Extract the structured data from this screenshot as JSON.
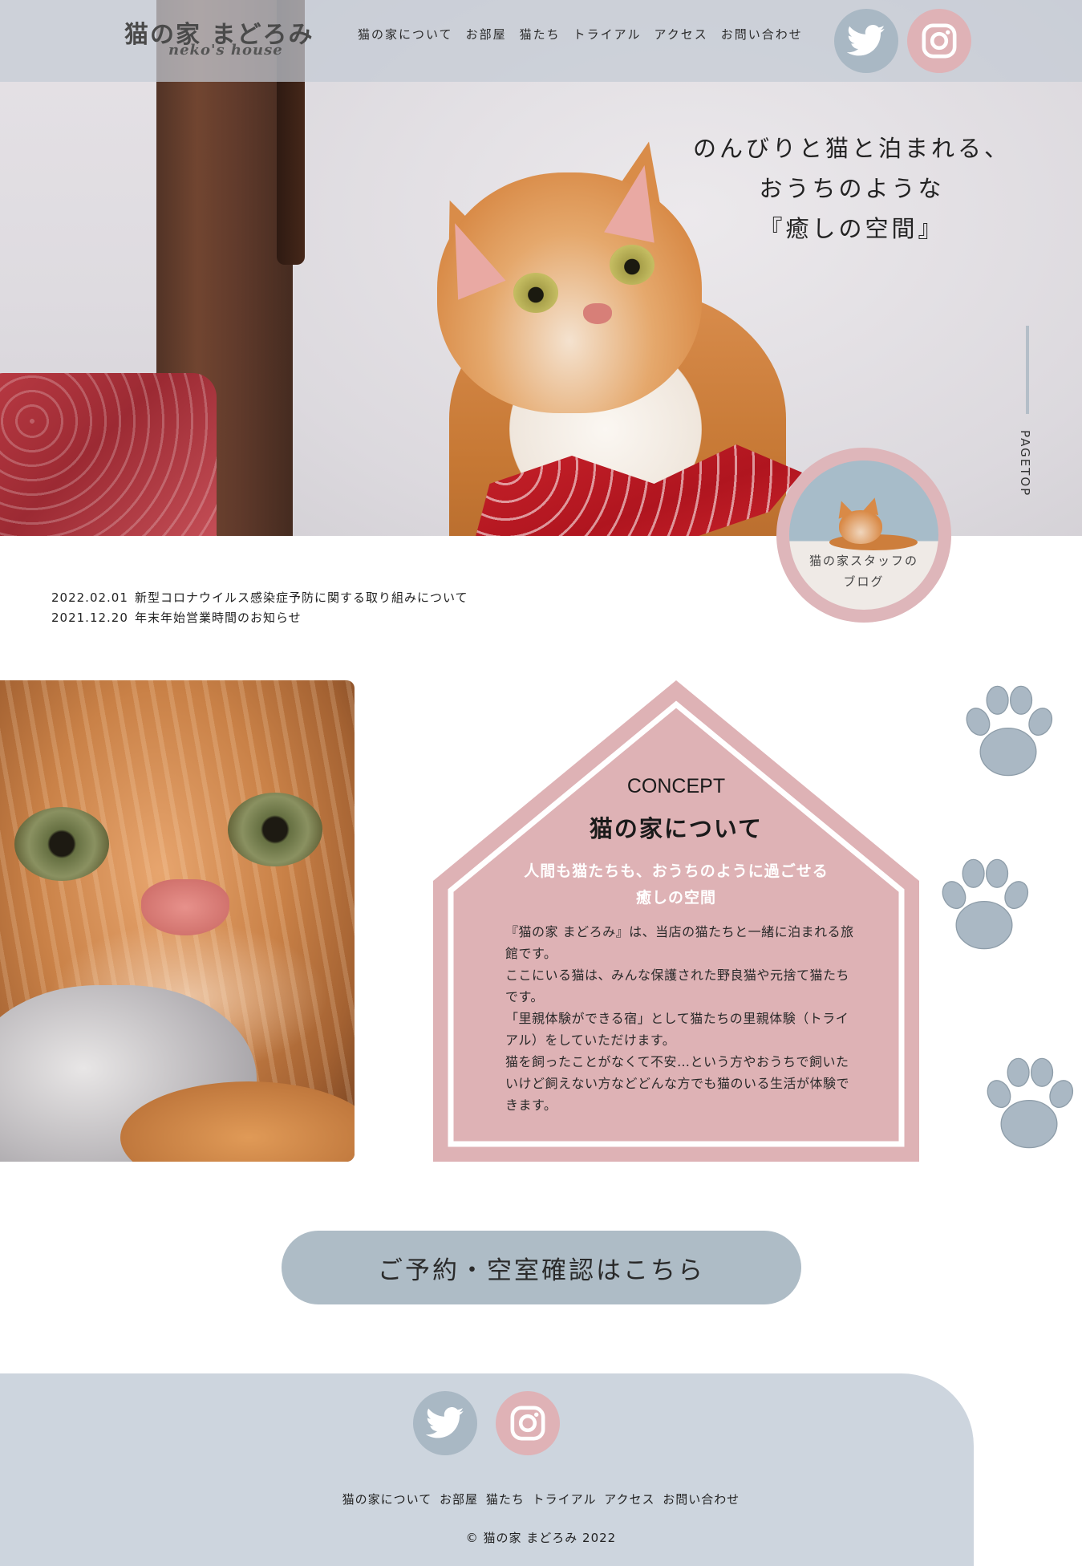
{
  "header": {
    "logo_jp": "猫の家 まどろみ",
    "logo_en": "neko's house",
    "nav": [
      "猫の家について",
      "お部屋",
      "猫たち",
      "トライアル",
      "アクセス",
      "お問い合わせ"
    ]
  },
  "social": {
    "twitter": "twitter-icon",
    "instagram": "instagram-icon",
    "colors": {
      "twitter_bg": "#a9b8c4",
      "instagram_bg": "#dfb2b6"
    }
  },
  "hero": {
    "copy": [
      "のんびりと猫と泊まれる、",
      "おうちのような",
      "『癒しの空間』"
    ],
    "pagetop": "PAGETOP"
  },
  "blog_badge": {
    "line1": "猫の家スタッフの",
    "line2": "ブログ"
  },
  "news": [
    {
      "date": "2022.02.01",
      "title": "新型コロナウイルス感染症予防に関する取り組みについて"
    },
    {
      "date": "2021.12.20",
      "title": "年末年始営業時間のお知らせ"
    }
  ],
  "concept": {
    "label_en": "CONCEPT",
    "title": "猫の家について",
    "subtitle_1": "人間も猫たちも、おうちのように過ごせる",
    "subtitle_2": "癒しの空間",
    "body": [
      "『猫の家 まどろみ』は、当店の猫たちと一緒に泊まれる旅館です。",
      "ここにいる猫は、みんな保護された野良猫や元捨て猫たちです。",
      "「里親体験ができる宿」として猫たちの里親体験（トライアル）をしていただけます。",
      "猫を飼ったことがなくて不安…という方やおうちで飼いたいけど飼えない方などどんな方でも猫のいる生活が体験できます。"
    ],
    "colors": {
      "house_fill": "#deb2b5",
      "paw": "#aab8c4"
    }
  },
  "reserve": {
    "label": "ご予約・空室確認はこちら"
  },
  "footer": {
    "nav": [
      "猫の家について",
      "お部屋",
      "猫たち",
      "トライアル",
      "アクセス",
      "お問い合わせ"
    ],
    "copyright": "© 猫の家 まどろみ 2022"
  }
}
